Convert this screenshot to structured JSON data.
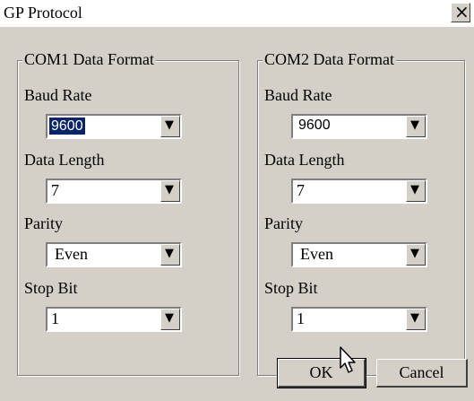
{
  "window": {
    "title": "GP Protocol",
    "close_glyph": "×"
  },
  "com1": {
    "legend": "COM1 Data Format",
    "baud_label": "Baud Rate",
    "baud_value": "9600",
    "length_label": "Data Length",
    "length_value": "7",
    "parity_label": "Parity",
    "parity_value": "Even",
    "stop_label": "Stop Bit",
    "stop_value": "1"
  },
  "com2": {
    "legend": "COM2 Data Format",
    "baud_label": "Baud Rate",
    "baud_value": "9600",
    "length_label": "Data Length",
    "length_value": "7",
    "parity_label": "Parity",
    "parity_value": "Even",
    "stop_label": "Stop Bit",
    "stop_value": "1"
  },
  "buttons": {
    "ok": "OK",
    "cancel": "Cancel"
  },
  "icons": {
    "dropdown": "▼",
    "close": "close-icon",
    "cursor": "arrow-cursor"
  },
  "colors": {
    "selection": "#0a246a",
    "face": "#d4d0c8"
  }
}
